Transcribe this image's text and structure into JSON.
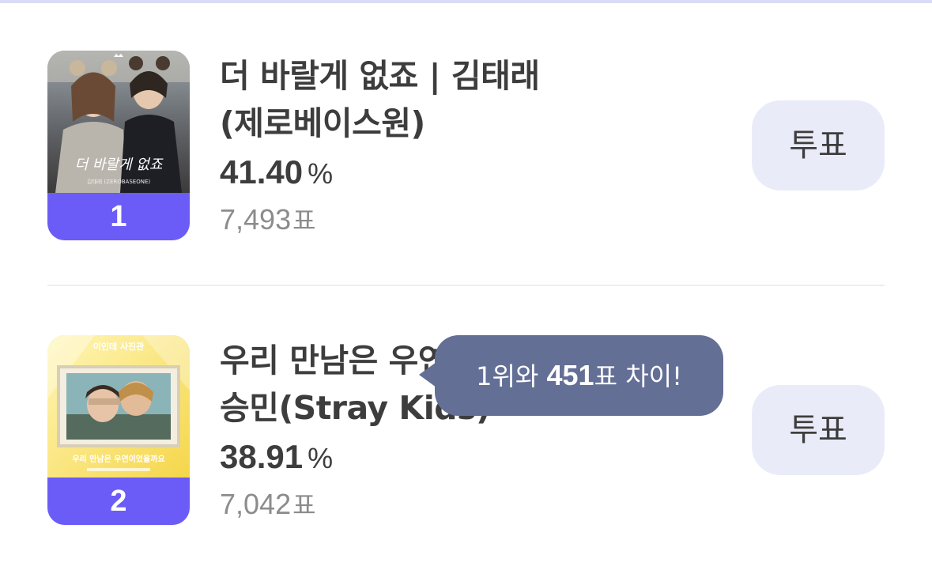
{
  "colors": {
    "accent": "#6b5cf7",
    "vote_button_bg": "#e9ecf8",
    "tooltip_bg": "#646f96",
    "text": "#3d3d3d",
    "muted_text": "#8c8c8c"
  },
  "entries": [
    {
      "rank": "1",
      "title_line1": "더 바랄게 없죠 | 김태래",
      "title_line2": "(제로베이스원)",
      "percent": "41.40",
      "percent_unit": "%",
      "votes": "7,493",
      "votes_unit": "표",
      "vote_label": "투표",
      "cover_text": "더 바랄게 없죠",
      "cover_subtext": "김태래 (ZEROBASEONE)"
    },
    {
      "rank": "2",
      "title_line1": "우리 만남은 우연이었을까요 |",
      "title_line2": "승민(Stray Kids)",
      "percent": "38.91",
      "percent_unit": "%",
      "votes": "7,042",
      "votes_unit": "표",
      "vote_label": "투표",
      "cover_text": "우리 만남은 우연이었을까요",
      "cover_subtext": "이인데 사진관"
    }
  ],
  "tooltip": {
    "prefix": "1위와",
    "amount": "451",
    "suffix": "표 차이!"
  },
  "icons": [
    "crown-icon"
  ]
}
